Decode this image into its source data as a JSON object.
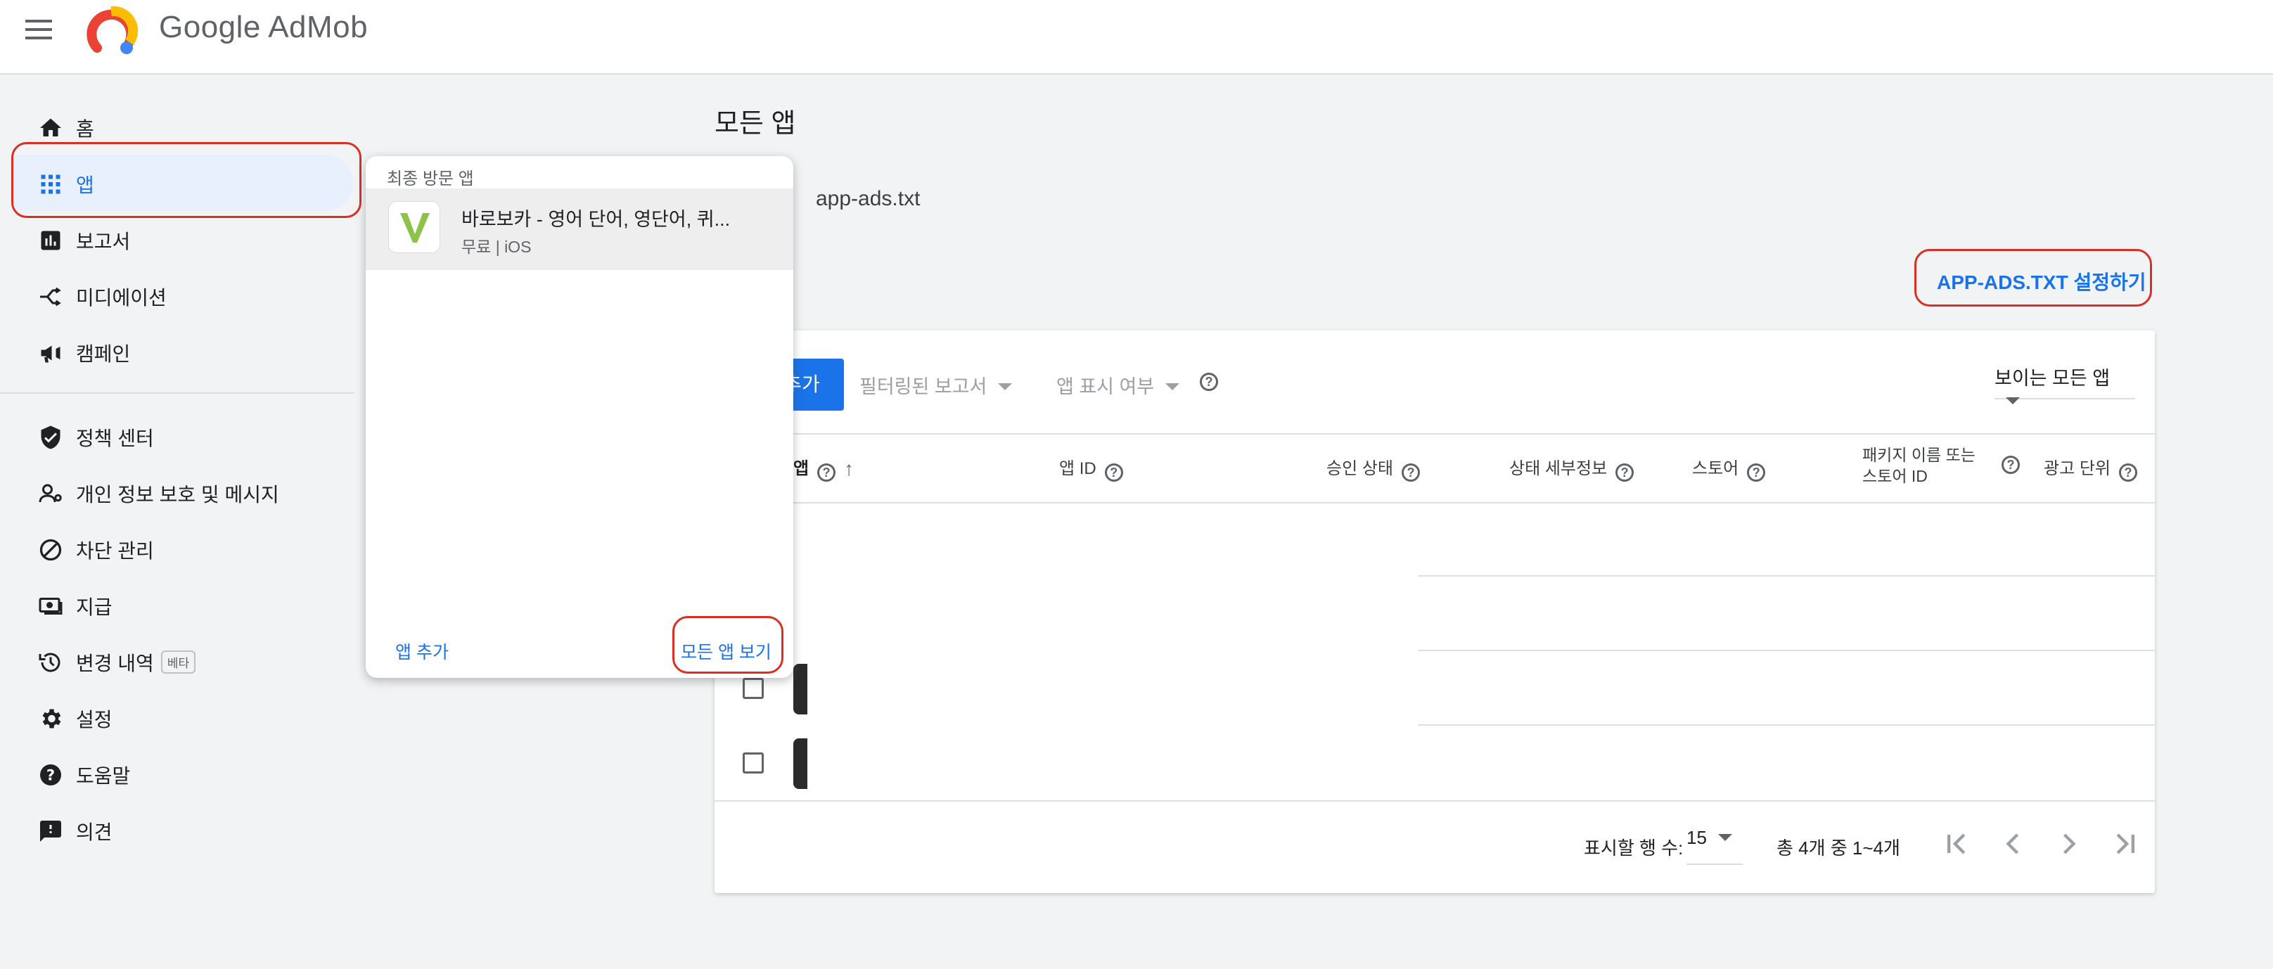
{
  "header": {
    "brand_google": "Google",
    "brand_product": "AdMob"
  },
  "sidebar": {
    "items": [
      {
        "label": "홈",
        "icon": "home-icon"
      },
      {
        "label": "앱",
        "icon": "apps-grid-icon",
        "active": true
      },
      {
        "label": "보고서",
        "icon": "bar-chart-icon"
      },
      {
        "label": "미디에이션",
        "icon": "mediation-icon"
      },
      {
        "label": "캠페인",
        "icon": "megaphone-icon"
      },
      {
        "label": "정책 센터",
        "icon": "shield-check-icon"
      },
      {
        "label": "개인 정보 보호 및 메시지",
        "icon": "person-settings-icon"
      },
      {
        "label": "차단 관리",
        "icon": "block-icon"
      },
      {
        "label": "지급",
        "icon": "payments-icon"
      },
      {
        "label": "변경 내역",
        "icon": "history-icon",
        "badge": "베타"
      },
      {
        "label": "설정",
        "icon": "gear-icon"
      },
      {
        "label": "도움말",
        "icon": "help-icon"
      },
      {
        "label": "의견",
        "icon": "feedback-icon"
      }
    ]
  },
  "main": {
    "title": "모든 앱",
    "appads_label": "app-ads.txt",
    "setup_link": "APP-ADS.TXT 설정하기",
    "toolbar": {
      "add_button_partial": "추가",
      "filtered_report": "필터링된 보고서",
      "app_visibility": "앱 표시 여부",
      "visible_select": "보이는 모든 앱"
    },
    "table": {
      "headers": {
        "app": "앱",
        "app_id": "앱 ID",
        "approval": "승인 상태",
        "status_detail": "상태 세부정보",
        "store": "스토어",
        "package_line1": "패키지 이름 또는",
        "package_line2": "스토어 ID",
        "ad_units": "광고 단위"
      }
    },
    "pagination": {
      "rows_label": "표시할 행 수:",
      "rows_value": "15",
      "range": "총 4개 중 1~4개"
    }
  },
  "popup": {
    "header": "최종 방문 앱",
    "recent_app": {
      "title": "바로보카 - 영어 단어, 영단어, 퀴...",
      "subtitle": "무료 | iOS"
    },
    "add_app": "앱 추가",
    "view_all": "모든 앱 보기"
  },
  "colors": {
    "accent": "#1a73e8",
    "highlight": "#d93025",
    "logo_green": "#8bc34a"
  }
}
